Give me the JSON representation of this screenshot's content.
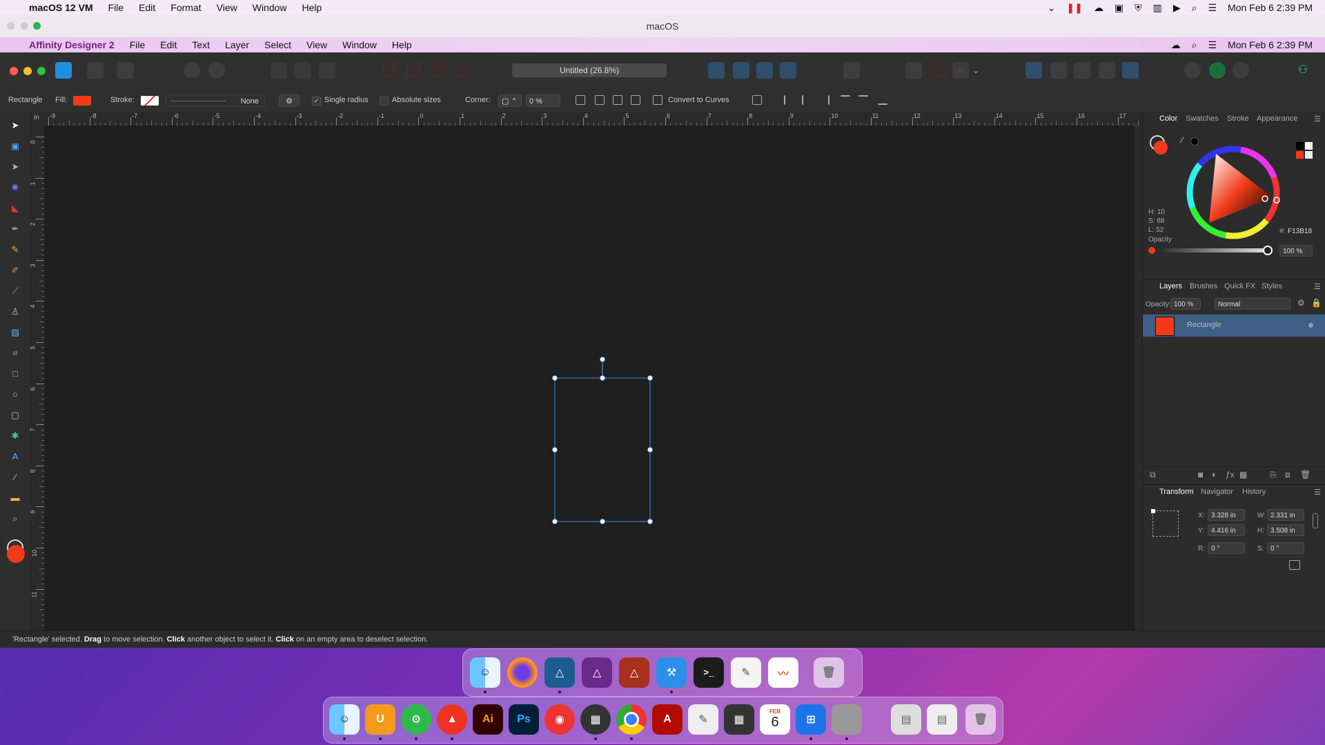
{
  "host_menubar": {
    "app": "macOS 12 VM",
    "items": [
      "File",
      "Edit",
      "Format",
      "View",
      "Window",
      "Help"
    ],
    "clock": "Mon Feb 6  2:39 PM"
  },
  "host_window_title": "macOS",
  "guest_menubar": {
    "app": "Affinity Designer 2",
    "items": [
      "File",
      "Edit",
      "Text",
      "Layer",
      "Select",
      "View",
      "Window",
      "Help"
    ],
    "clock": "Mon Feb 6  2:39 PM"
  },
  "document": {
    "title": "Untitled (26.8%)"
  },
  "context_toolbar": {
    "object": "Rectangle",
    "fill_label": "Fill:",
    "fill_color": "#F13B18",
    "stroke_label": "Stroke:",
    "stroke_style": "None",
    "single_radius_label": "Single radius",
    "single_radius_checked": true,
    "absolute_sizes_label": "Absolute sizes",
    "corner_label": "Corner:",
    "corner_value": "0 %",
    "convert_label": "Convert to Curves"
  },
  "ruler": {
    "h_unit": "in",
    "h_ticks": [
      "-9",
      "-8",
      "-7",
      "-6",
      "-5",
      "-4",
      "-3",
      "-2",
      "-1",
      "0",
      "1",
      "2",
      "3",
      "4",
      "5",
      "6",
      "7",
      "8",
      "9",
      "10",
      "11",
      "12",
      "13",
      "14",
      "15",
      "16",
      "17"
    ],
    "v_ticks": [
      "0",
      "1",
      "2",
      "3",
      "4",
      "5",
      "6",
      "7",
      "8",
      "9",
      "10",
      "11"
    ]
  },
  "color_panel": {
    "tabs": [
      "Color",
      "Swatches",
      "Stroke",
      "Appearance"
    ],
    "h": "H: 10",
    "s": "S: 88",
    "l": "L: 52",
    "hex_label": "#:",
    "hex": "F13B18",
    "opacity_label": "Opacity",
    "opacity_value": "100 %"
  },
  "layers_panel": {
    "tabs": [
      "Layers",
      "Brushes",
      "Quick FX",
      "Styles"
    ],
    "opacity_label": "Opacity:",
    "opacity_value": "100 %",
    "blend": "Normal",
    "layers": [
      {
        "name": "Rectangle"
      }
    ]
  },
  "transform_panel": {
    "tabs": [
      "Transform",
      "Navigator",
      "History"
    ],
    "x_label": "X:",
    "x": "3.328 in",
    "y_label": "Y:",
    "y": "4.416 in",
    "w_label": "W:",
    "w": "2.331 in",
    "h_label": "H:",
    "h": "3.508 in",
    "r_label": "R:",
    "r": "0 °",
    "s_label": "S:",
    "s": "0 °"
  },
  "status": {
    "p1": "'Rectangle' selected.",
    "b1": "Drag",
    "p2": "to move selection.",
    "b2": "Click",
    "p3": "another object to select it.",
    "b3": "Click",
    "p4": "on an empty area to deselect selection."
  },
  "dock_inner_icons": [
    "finder-icon",
    "firefox-icon",
    "affinity-designer-icon",
    "affinity-photo-icon",
    "affinity-publisher-icon",
    "xcode-icon",
    "terminal-icon",
    "textedit-icon",
    "freeform-icon",
    "trash-icon"
  ],
  "dock_outer": {
    "icons": [
      "finder-icon",
      "magnet-icon",
      "settings-icon",
      "autocad-icon",
      "illustrator-icon",
      "photoshop-icon",
      "screen-recorder-icon",
      "launchpad-icon",
      "chrome-icon",
      "acrobat-icon",
      "script-editor-icon",
      "calculator-icon",
      "calendar-icon",
      "windows-icon",
      "mac-vm-icon",
      "documents-icon",
      "downloads-icon",
      "trash-icon"
    ],
    "ai_label": "Ai",
    "ps_label": "Ps",
    "cal_month": "FEB",
    "cal_day": "6"
  }
}
